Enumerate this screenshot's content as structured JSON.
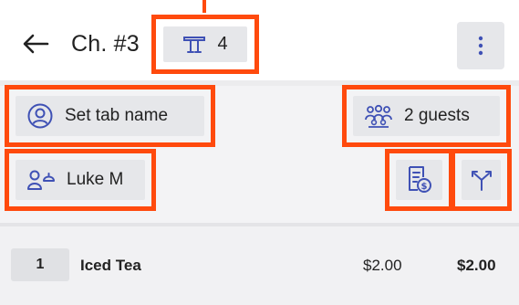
{
  "header": {
    "title": "Ch. #3",
    "table_number": "4"
  },
  "actions": {
    "tab_name_label": "Set tab name",
    "guests_label": "2 guests",
    "server_label": "Luke M"
  },
  "order_items": [
    {
      "qty": "1",
      "name": "Iced Tea",
      "unit_price": "$2.00",
      "total": "$2.00"
    }
  ],
  "icons": {
    "back": "arrow-left-icon",
    "table": "table-icon",
    "more": "more-vertical-icon",
    "tab_name": "person-circle-icon",
    "guests": "group-icon",
    "server": "server-icon",
    "check": "receipt-dollar-icon",
    "split": "split-icon"
  },
  "colors": {
    "highlight": "#ff4a0d",
    "accent": "#3f51b5",
    "pill_bg": "#e6e7ea",
    "section_bg": "#f3f3f5"
  }
}
